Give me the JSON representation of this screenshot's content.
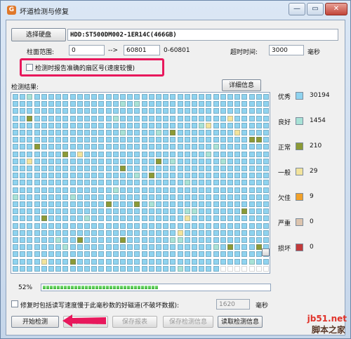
{
  "window": {
    "title": "坏道检测与修复",
    "app_icon": "app-icon"
  },
  "titlebar_buttons": {
    "minimize": "—",
    "restore": "▭",
    "close": "✕"
  },
  "disk": {
    "select_button": "选择硬盘",
    "name": "HDD:ST500DM002-1ER14C(466GB)"
  },
  "cylinder": {
    "label": "柱面范围:",
    "start": "0",
    "arrow": "-->",
    "end": "60801",
    "range": "0-60801"
  },
  "timeout": {
    "label": "超时时间:",
    "value": "3000",
    "unit": "毫秒"
  },
  "report_sector": {
    "label": "检测时报告准确的扇区号(速度较慢)",
    "checked": false
  },
  "results": {
    "label": "检测结果:",
    "detail_button": "详细信息"
  },
  "legend": [
    {
      "name": "优秀",
      "count": "30194",
      "color": "#8fd3ef"
    },
    {
      "name": "良好",
      "count": "1454",
      "color": "#a8e2d6"
    },
    {
      "name": "正常",
      "count": "210",
      "color": "#8c9a36"
    },
    {
      "name": "一般",
      "count": "29",
      "color": "#f2e39c"
    },
    {
      "name": "欠佳",
      "count": "9",
      "color": "#f1a12a"
    },
    {
      "name": "严重",
      "count": "0",
      "color": "#dcc4ae"
    },
    {
      "name": "损坏",
      "count": "0",
      "color": "#c23a3a"
    }
  ],
  "progress": {
    "percent_label": "52%",
    "fraction": 0.52
  },
  "repair": {
    "label": "修复时包括读写速度慢于此毫秒数的好磁道(不破坏数据):",
    "value": "1620",
    "unit": "毫秒",
    "checked": false
  },
  "buttons": {
    "start": "开始检测",
    "stop": "停止检测",
    "save_report": "保存报表",
    "save_info": "保存检测信息",
    "read_info": "读取检测信息"
  },
  "watermark": {
    "line1": "jb51.net",
    "line2": "脚本之家"
  }
}
